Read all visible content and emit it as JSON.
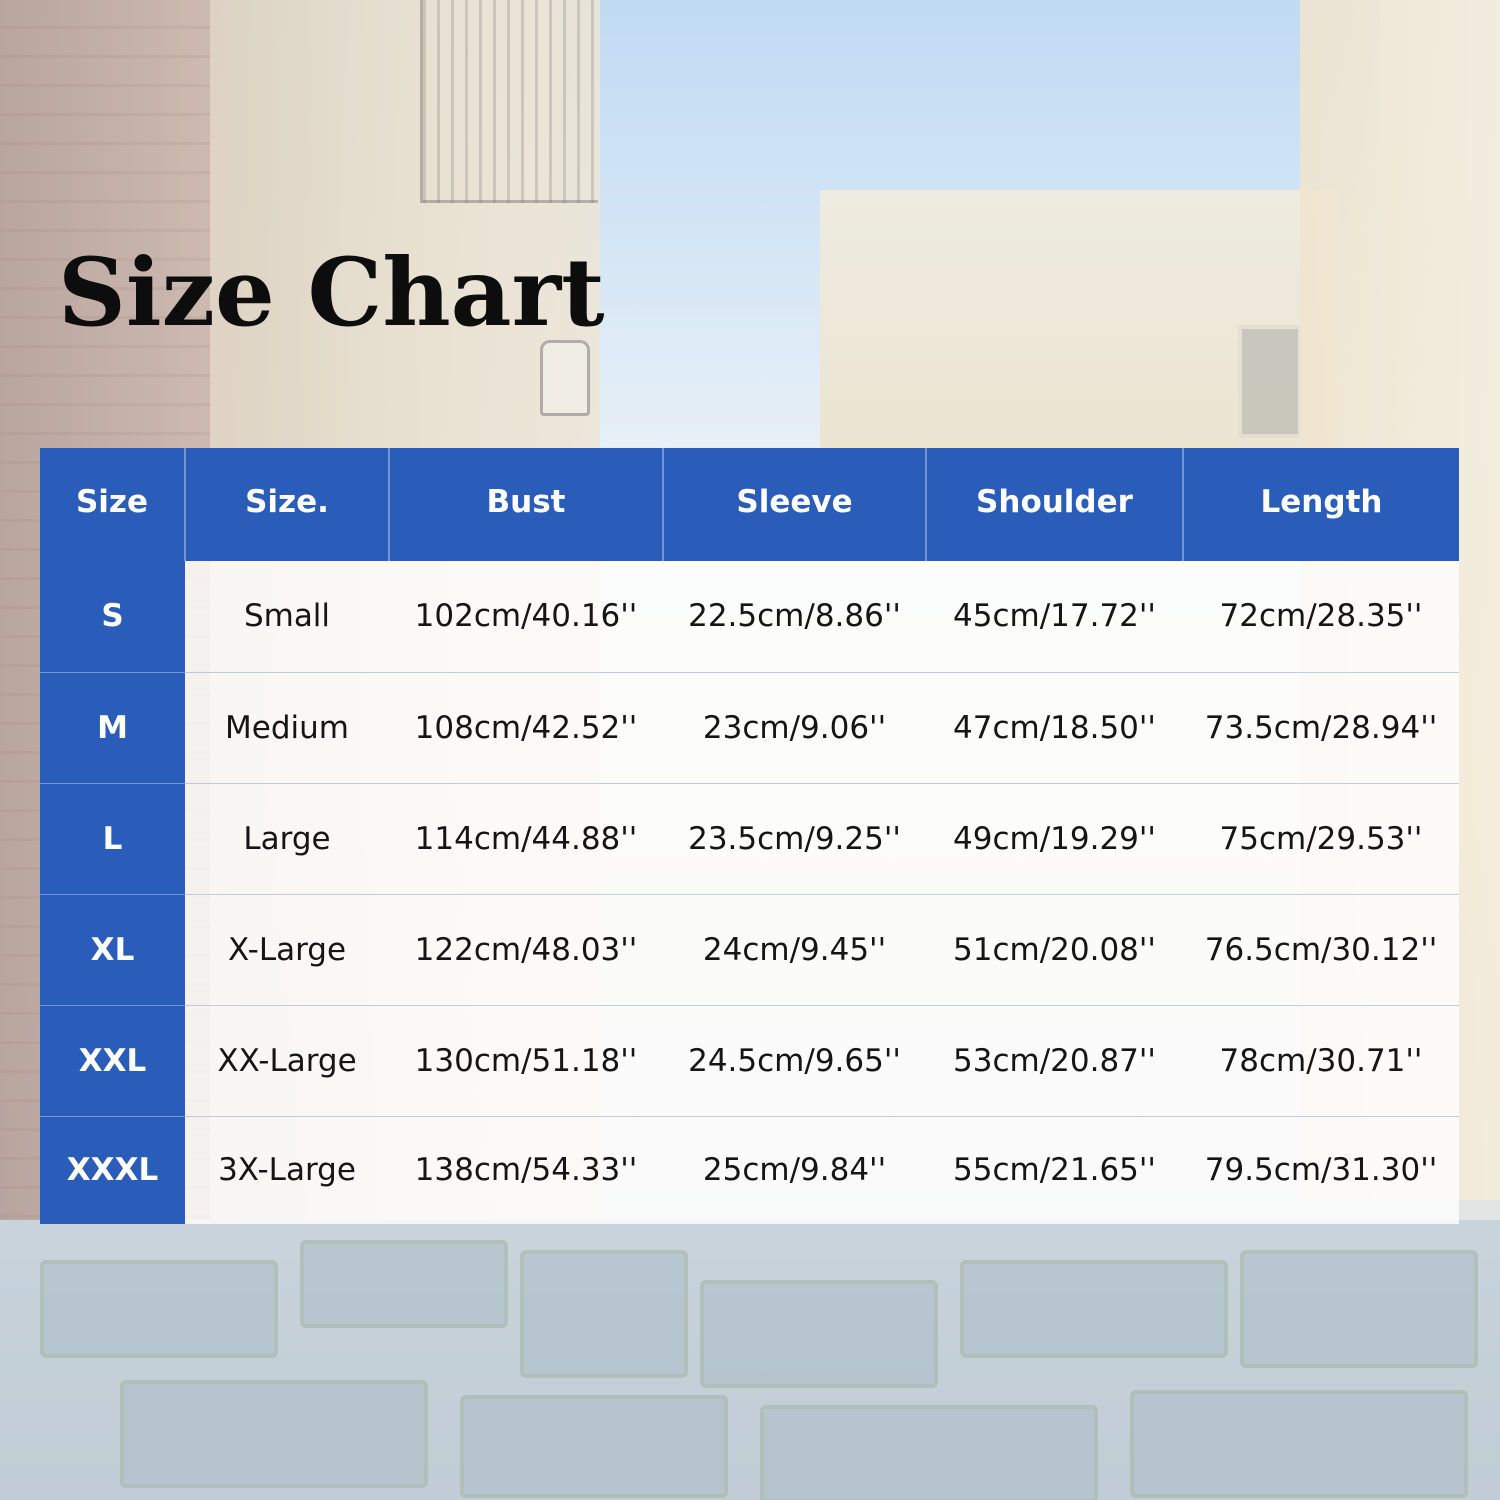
{
  "title": "Size Chart",
  "colors": {
    "header_blue": "#2a5cb9",
    "header_text": "#ffffff",
    "body_text": "#151515"
  },
  "table": {
    "headers": [
      "Size",
      "Size.",
      "Bust",
      "Sleeve",
      "Shoulder",
      "Length"
    ],
    "rows": [
      {
        "size": "S",
        "name": "Small",
        "bust": "102cm/40.16''",
        "sleeve": "22.5cm/8.86''",
        "shoulder": "45cm/17.72''",
        "length": "72cm/28.35''"
      },
      {
        "size": "M",
        "name": "Medium",
        "bust": "108cm/42.52''",
        "sleeve": "23cm/9.06''",
        "shoulder": "47cm/18.50''",
        "length": "73.5cm/28.94''"
      },
      {
        "size": "L",
        "name": "Large",
        "bust": "114cm/44.88''",
        "sleeve": "23.5cm/9.25''",
        "shoulder": "49cm/19.29''",
        "length": "75cm/29.53''"
      },
      {
        "size": "XL",
        "name": "X-Large",
        "bust": "122cm/48.03''",
        "sleeve": "24cm/9.45''",
        "shoulder": "51cm/20.08''",
        "length": "76.5cm/30.12''"
      },
      {
        "size": "XXL",
        "name": "XX-Large",
        "bust": "130cm/51.18''",
        "sleeve": "24.5cm/9.65''",
        "shoulder": "53cm/20.87''",
        "length": "78cm/30.71''"
      },
      {
        "size": "XXXL",
        "name": "3X-Large",
        "bust": "138cm/54.33''",
        "sleeve": "25cm/9.84''",
        "shoulder": "55cm/21.65''",
        "length": "79.5cm/31.30''"
      }
    ]
  }
}
